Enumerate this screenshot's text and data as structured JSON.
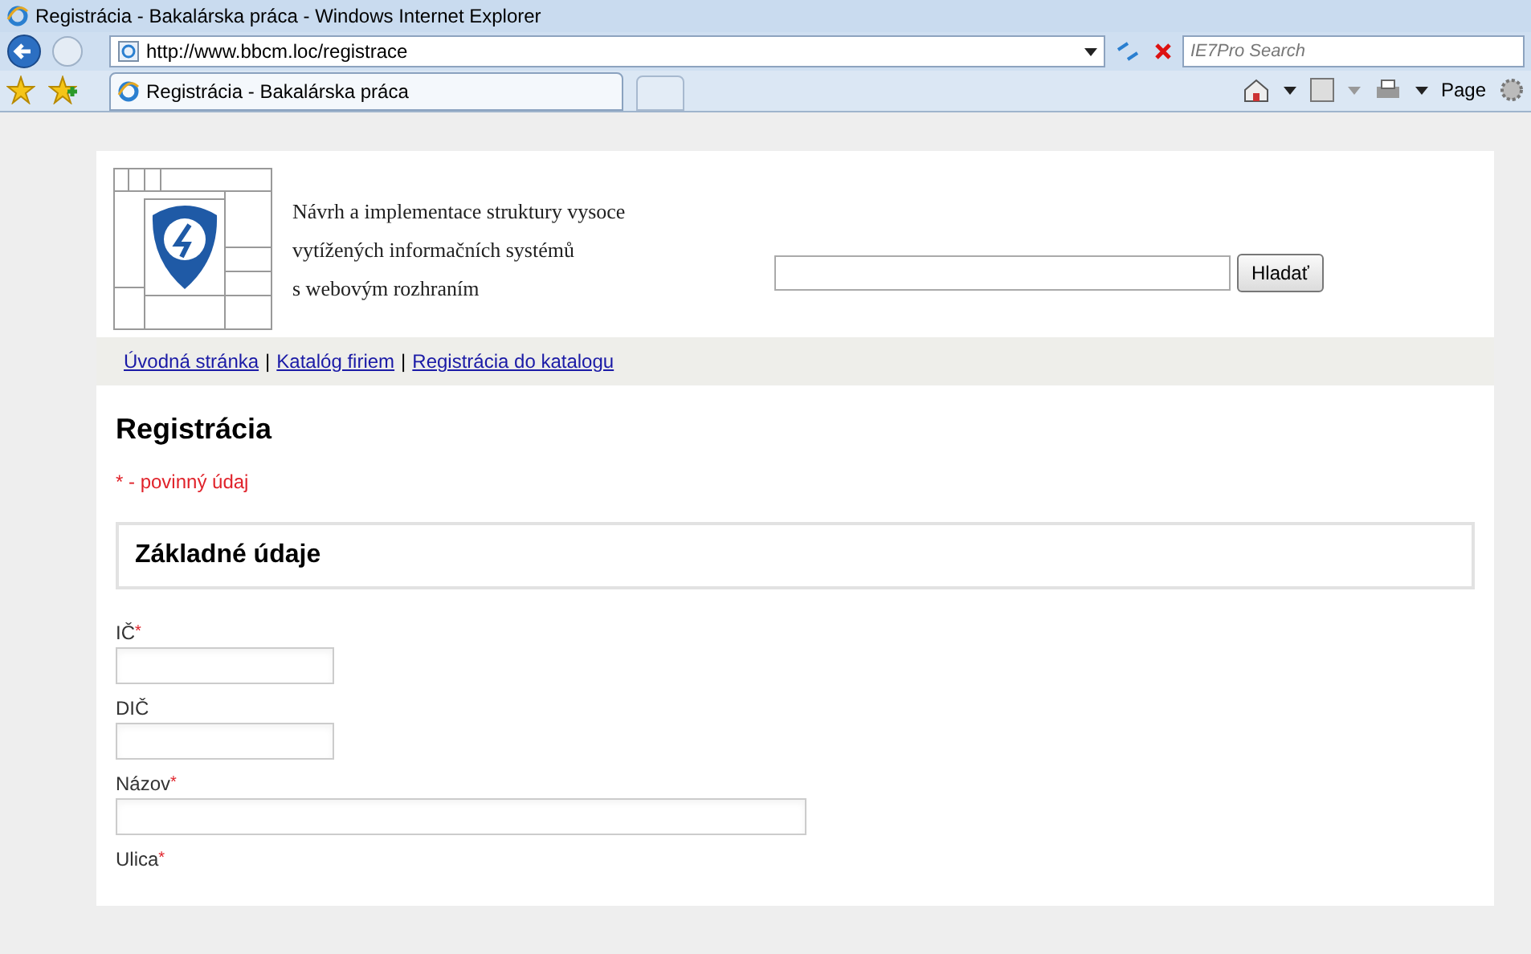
{
  "window": {
    "title": "Registrácia - Bakalárska práca - Windows Internet Explorer"
  },
  "address_bar": {
    "url": "http://www.bbcm.loc/registrace"
  },
  "search_box": {
    "placeholder": "IE7Pro Search"
  },
  "tabs": [
    {
      "label": "Registrácia - Bakalárska práca",
      "selected": true
    }
  ],
  "toolbar": {
    "page_button": "Page"
  },
  "site_header": {
    "title_lines": [
      "Návrh a implementace struktury vysoce",
      "vytížených informačních systémů",
      "s webovým rozhraním"
    ],
    "search_button": "Hladať"
  },
  "nav_links": [
    "Úvodná stránka",
    "Katalóg firiem",
    "Registrácia do katalogu"
  ],
  "nav_separator": "|",
  "page_heading": "Registrácia",
  "required_note": "* - povinný údaj",
  "section_heading": "Základné údaje",
  "fields": [
    {
      "label": "IČ",
      "required": true,
      "kind": "short"
    },
    {
      "label": "DIČ",
      "required": false,
      "kind": "short"
    },
    {
      "label": "Názov",
      "required": true,
      "kind": "long"
    },
    {
      "label": "Ulica",
      "required": true,
      "kind": "label"
    }
  ],
  "required_mark": "*"
}
